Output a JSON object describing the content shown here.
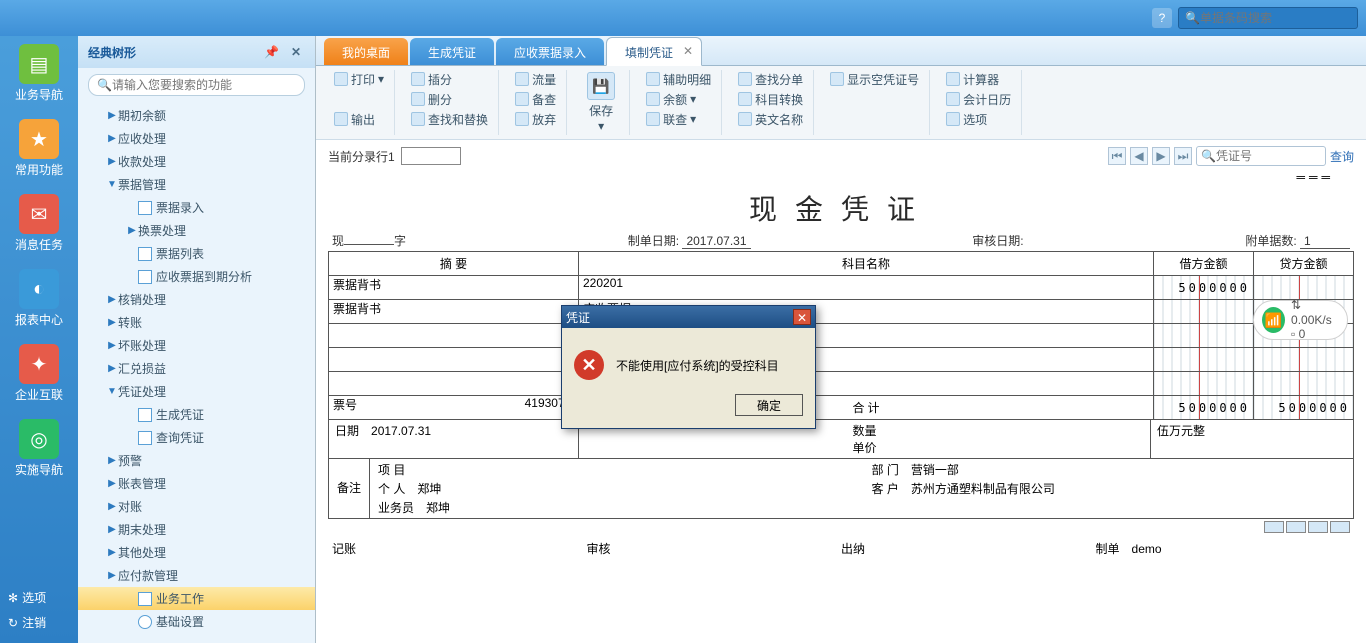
{
  "topbar": {
    "search_placeholder": "单据条码搜索"
  },
  "sidebar": {
    "items": [
      {
        "label": "业务导航",
        "color": "#6fbf3f"
      },
      {
        "label": "常用功能",
        "color": "#f6a33a"
      },
      {
        "label": "消息任务",
        "color": "#e65b4a"
      },
      {
        "label": "报表中心",
        "color": "#3a9ad9"
      },
      {
        "label": "企业互联",
        "color": "#e65b4a"
      },
      {
        "label": "实施导航",
        "color": "#2abb67"
      }
    ],
    "bottom": [
      {
        "label": "选项",
        "icon": "✻"
      },
      {
        "label": "注销",
        "icon": "↻"
      }
    ]
  },
  "tree": {
    "title": "经典树形",
    "search_placeholder": "请输入您要搜索的功能",
    "nodes": [
      {
        "label": "期初余额",
        "level": 1,
        "arrow": "▶"
      },
      {
        "label": "应收处理",
        "level": 1,
        "arrow": "▶"
      },
      {
        "label": "收款处理",
        "level": 1,
        "arrow": "▶"
      },
      {
        "label": "票据管理",
        "level": 1,
        "arrow": "▼"
      },
      {
        "label": "票据录入",
        "level": 2,
        "file": true
      },
      {
        "label": "换票处理",
        "level": 2,
        "arrow": "▶"
      },
      {
        "label": "票据列表",
        "level": 2,
        "file": true
      },
      {
        "label": "应收票据到期分析",
        "level": 2,
        "file": true
      },
      {
        "label": "核销处理",
        "level": 1,
        "arrow": "▶"
      },
      {
        "label": "转账",
        "level": 1,
        "arrow": "▶"
      },
      {
        "label": "坏账处理",
        "level": 1,
        "arrow": "▶"
      },
      {
        "label": "汇兑损益",
        "level": 1,
        "arrow": "▶"
      },
      {
        "label": "凭证处理",
        "level": 1,
        "arrow": "▼"
      },
      {
        "label": "生成凭证",
        "level": 2,
        "file": true
      },
      {
        "label": "查询凭证",
        "level": 2,
        "file": true
      },
      {
        "label": "预警",
        "level": 1,
        "arrow": "▶"
      },
      {
        "label": "账表管理",
        "level": 1,
        "arrow": "▶"
      },
      {
        "label": "对账",
        "level": 1,
        "arrow": "▶"
      },
      {
        "label": "期末处理",
        "level": 1,
        "arrow": "▶"
      },
      {
        "label": "其他处理",
        "level": 1,
        "arrow": "▶"
      },
      {
        "label": "应付款管理",
        "level": 1,
        "arrow": "▶"
      },
      {
        "label": "业务工作",
        "level": 2,
        "file": true,
        "active": true
      },
      {
        "label": "基础设置",
        "level": 2,
        "gear": true
      }
    ]
  },
  "tabs": [
    {
      "label": "我的桌面",
      "type": "orange"
    },
    {
      "label": "生成凭证",
      "type": "blue"
    },
    {
      "label": "应收票据录入",
      "type": "blue"
    },
    {
      "label": "填制凭证",
      "type": "active"
    }
  ],
  "ribbon": {
    "print": "打印",
    "output": "输出",
    "insert": "插分",
    "delete": "删分",
    "findreplace": "查找和替换",
    "flow": "流量",
    "backup": "备查",
    "discard": "放弃",
    "save": "保存",
    "aux": "辅助明细",
    "balance": "余额",
    "linked": "联查",
    "findentry": "查找分单",
    "subjconv": "科目转换",
    "engname": "英文名称",
    "showempty": "显示空凭证号",
    "calc": "计算器",
    "calendar": "会计日历",
    "options": "选项"
  },
  "voucher": {
    "cur_line_label": "当前分录行1",
    "nav_search_placeholder": "凭证号",
    "query": "查询",
    "title": "现金凭证",
    "prefix": "现",
    "suffix": "字",
    "make_date_label": "制单日期:",
    "make_date": "2017.07.31",
    "audit_date_label": "审核日期:",
    "audit_date": "",
    "attach_label": "附单据数:",
    "attach": "1",
    "col_summary": "摘 要",
    "col_subject": "科目名称",
    "col_debit": "借方金额",
    "col_credit": "贷方金额",
    "rows": [
      {
        "summary": "票据背书",
        "subject": "220201",
        "debit": "5000000",
        "credit": ""
      },
      {
        "summary": "票据背书",
        "subject": "应收票据",
        "debit": "",
        "credit": ""
      },
      {
        "summary": "",
        "subject": "",
        "debit": "",
        "credit": ""
      },
      {
        "summary": "",
        "subject": "",
        "debit": "",
        "credit": ""
      },
      {
        "summary": "",
        "subject": "",
        "debit": "",
        "credit": ""
      }
    ],
    "total_label": "合 计",
    "total_debit": "5000000",
    "total_credit": "5000000",
    "bill_no_label": "票号",
    "bill_no": "41930777",
    "date_label": "日期",
    "date": "2017.07.31",
    "qty_label": "数量",
    "price_label": "单价",
    "amount_text": "伍万元整",
    "remark_label": "备注",
    "project_label": "项 目",
    "project": "",
    "dept_label": "部 门",
    "dept": "营销一部",
    "person_label": "个 人",
    "person": "郑坤",
    "customer_label": "客 户",
    "customer": "苏州方通塑料制品有限公司",
    "operator_label": "业务员",
    "operator": "郑坤",
    "sig_book": "记账",
    "sig_audit": "审核",
    "sig_cashier": "出纳",
    "sig_make": "制单",
    "sig_maker": "demo"
  },
  "modal": {
    "title": "凭证",
    "message": "不能使用[应付系统]的受控科目",
    "ok": "确定"
  },
  "wifi": {
    "speed": "0.00K/s",
    "count": "0"
  }
}
